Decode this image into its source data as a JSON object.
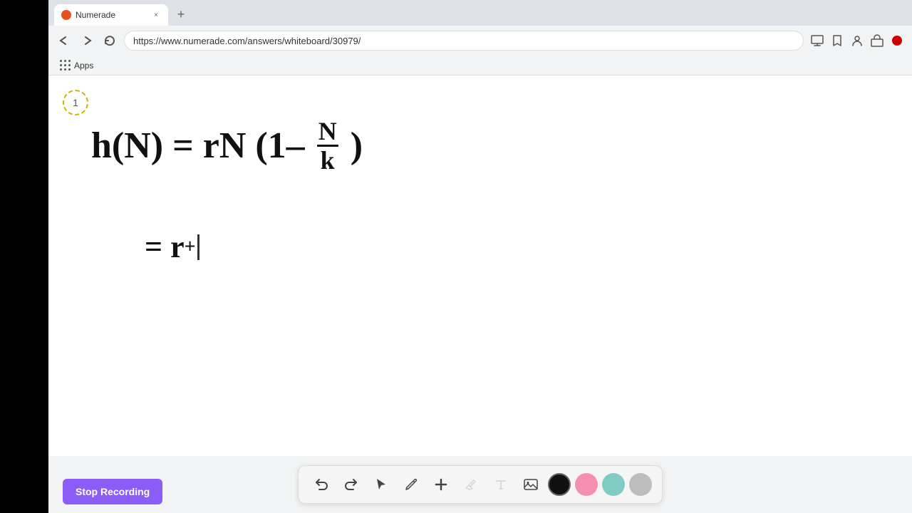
{
  "browser": {
    "tab": {
      "favicon": "numerade-icon",
      "title": "Numerade",
      "close_label": "×"
    },
    "new_tab_label": "+",
    "url": "https://www.numerade.com/answers/whiteboard/30979/",
    "nav": {
      "back_label": "←",
      "forward_label": "→",
      "refresh_label": "↻"
    }
  },
  "bookmarks": {
    "apps_label": "Apps"
  },
  "whiteboard": {
    "page_number": "1",
    "equation_line1_parts": [
      "h(N) = rN (1– ",
      "N",
      "k",
      ")"
    ],
    "equation_line2": "= r+"
  },
  "toolbar": {
    "undo_label": "↺",
    "redo_label": "↻",
    "select_label": "▶",
    "pen_label": "✏",
    "plus_label": "+",
    "eraser_label": "/",
    "text_label": "T",
    "image_label": "🖼",
    "colors": [
      "black",
      "pink",
      "green",
      "gray"
    ],
    "stop_recording_label": "Stop Recording"
  }
}
